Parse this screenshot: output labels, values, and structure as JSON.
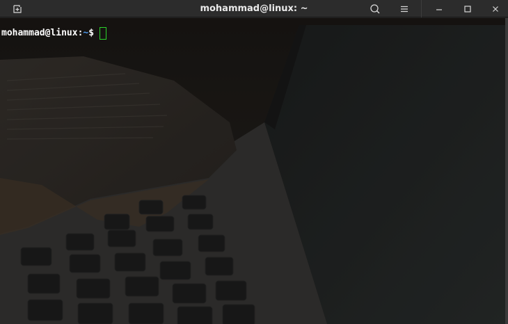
{
  "window": {
    "title": "mohammad@linux: ~"
  },
  "titlebar": {
    "new_tab_icon": "new-tab-icon",
    "search_icon": "search-icon",
    "menu_icon": "hamburger-menu-icon",
    "minimize_icon": "minimize-icon",
    "maximize_icon": "maximize-icon",
    "close_icon": "close-icon"
  },
  "terminal": {
    "prompt_user": "mohammad@linux",
    "prompt_colon": ":",
    "prompt_path": "~",
    "prompt_symbol": "$",
    "colors": {
      "user": "#ffffff",
      "path": "#4e9cf0",
      "cursor": "#2bd32b"
    }
  }
}
